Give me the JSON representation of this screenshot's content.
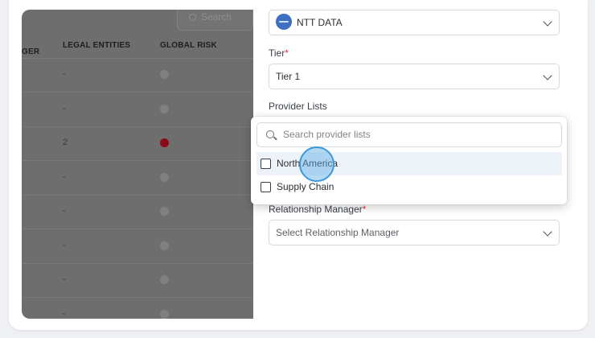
{
  "table": {
    "columns": {
      "manager_partial": "GER",
      "manager_sort": "↑↓",
      "legal_entities": "LEGAL ENTITIES",
      "global_risk": "GLOBAL RISK"
    },
    "search_placeholder": "Search",
    "rows": [
      {
        "legal_entities": "-",
        "risk": "grey"
      },
      {
        "legal_entities": "-",
        "risk": "grey"
      },
      {
        "legal_entities": "2",
        "risk": "red"
      },
      {
        "legal_entities": "-",
        "risk": "grey"
      },
      {
        "legal_entities": "-",
        "risk": "grey"
      },
      {
        "legal_entities": "-",
        "risk": "grey"
      },
      {
        "legal_entities": "-",
        "risk": "grey"
      },
      {
        "legal_entities": "-",
        "risk": "grey"
      }
    ]
  },
  "panel": {
    "provider_value": "NTT DATA",
    "tier_label": "Tier",
    "tier_required": "*",
    "tier_value": "Tier 1",
    "provider_lists_label": "Provider Lists",
    "relationship_manager_label": "Relationship Manager",
    "relationship_manager_required": "*",
    "relationship_manager_placeholder": "Select Relationship Manager"
  },
  "dropdown": {
    "search_placeholder": "Search provider lists",
    "options": [
      {
        "label": "North America",
        "checked": false
      },
      {
        "label": "Supply Chain",
        "checked": false
      }
    ]
  },
  "colors": {
    "risk_red": "#8b0a18",
    "risk_grey": "#808080",
    "required_red": "#e0303a",
    "click_ring": "#3d98d8"
  }
}
